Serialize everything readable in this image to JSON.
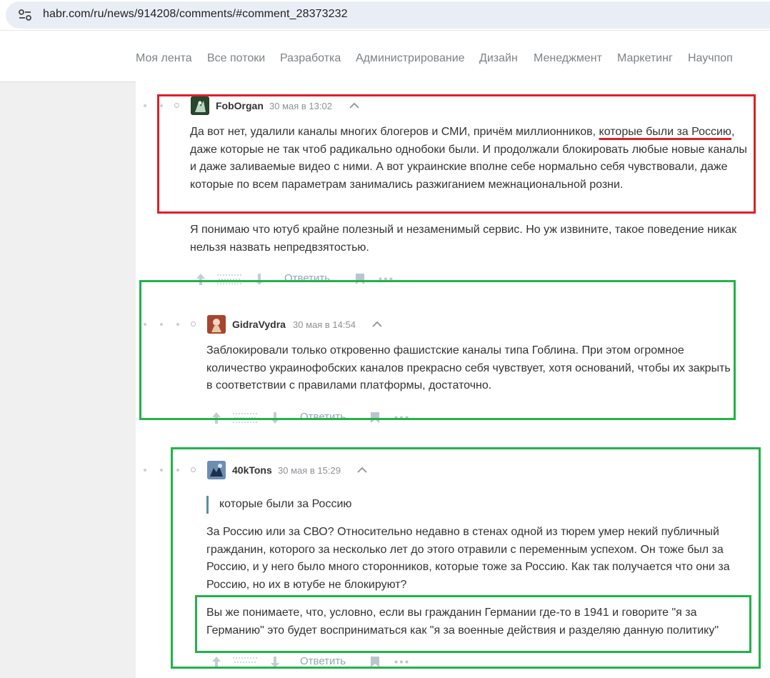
{
  "browser": {
    "url": "habr.com/ru/news/914208/comments/#comment_28373232"
  },
  "nav": {
    "items": [
      {
        "label": "Моя лента"
      },
      {
        "label": "Все потоки"
      },
      {
        "label": "Разработка"
      },
      {
        "label": "Администрирование"
      },
      {
        "label": "Дизайн"
      },
      {
        "label": "Менеджмент"
      },
      {
        "label": "Маркетинг"
      },
      {
        "label": "Научпоп"
      }
    ]
  },
  "comments": [
    {
      "username": "FobOrgan",
      "date": "30 мая в 13:02",
      "p1_part1": "Да вот нет, удалили каналы многих блогеров и СМИ, причём миллионников, ",
      "p1_underlined": "которые были за Россию",
      "p1_part2": ", даже которые не так чтоб радикально однобоки были. И продолжали блокировать любые новые каналы и даже заливаемые видео с ними. А вот украинские вполне себе нормально себя чувствовали, даже которые по всем параметрам занимались разжиганием межнациональной розни.",
      "p2": "Я понимаю что ютуб крайне полезный и незаменимый сервис. Но уж извините, такое поведение никак нельзя назвать непредвзятостью.",
      "reply_label": "Ответить"
    },
    {
      "username": "GidraVydra",
      "date": "30 мая в 14:54",
      "p1": "Заблокировали только откровенно фашистские каналы типа Гоблина. При этом огромное количество украинофобских каналов прекрасно себя чувствует, хотя оснований, чтобы их закрыть в соответствии с правилами платформы, достаточно.",
      "reply_label": "Ответить"
    },
    {
      "username": "40kTons",
      "date": "30 мая в 15:29",
      "quote": "которые были за Россию",
      "p1": "За Россию или за СВО? Относительно недавно в стенах одной из тюрем умер некий публичный гражданин, которого за несколько лет до этого отравили с переменным успехом. Он тоже был за Россию, и у него было много сторонников, которые тоже за Россию. Как так получается что они за Россию, но их в ютубе не блокируют?",
      "p2": "Вы же понимаете, что, условно, если вы гражданин Германии где-то в 1941 и говорите \"я за Германию\" это будет восприниматься как \"я за военные действия и разделяю данную политику\"",
      "reply_label": "Ответить"
    }
  ],
  "colors": {
    "highlight_red": "#e01f26",
    "highlight_green": "#23b24b",
    "quote_bar": "#5e8ca2",
    "nav_text": "#7c8388"
  }
}
